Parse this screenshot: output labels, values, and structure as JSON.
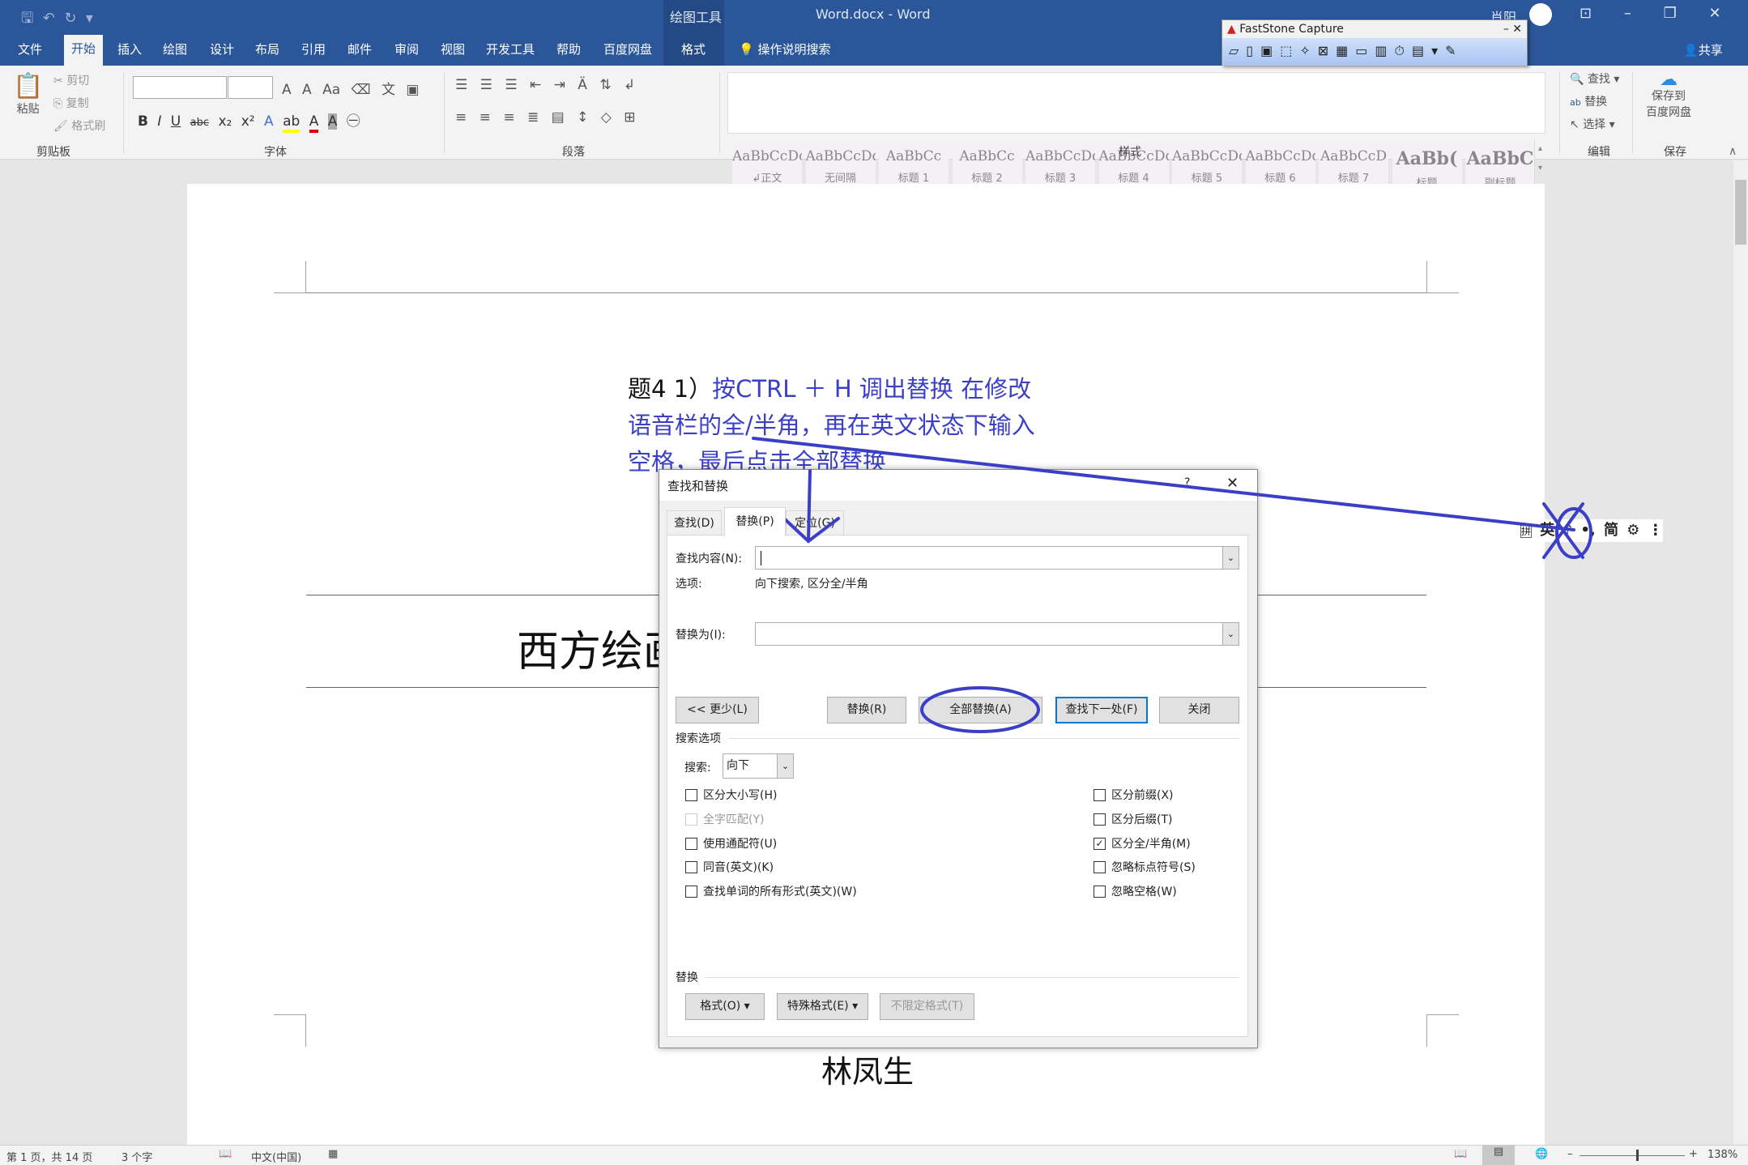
{
  "window": {
    "title": "Word.docx - Word",
    "context_tab_group": "绘图工具",
    "user": "肖阳",
    "share": "共享"
  },
  "tabs": [
    "文件",
    "开始",
    "插入",
    "绘图",
    "设计",
    "布局",
    "引用",
    "邮件",
    "审阅",
    "视图",
    "开发工具",
    "帮助",
    "百度网盘",
    "格式"
  ],
  "active_tab": "开始",
  "tell_me": "操作说明搜索",
  "ribbon": {
    "clipboard": {
      "label": "剪贴板",
      "paste": "粘贴",
      "cut": "剪切",
      "copy": "复制",
      "format_painter": "格式刷"
    },
    "font": {
      "label": "字体",
      "bold": "B",
      "italic": "I",
      "underline": "U",
      "strike": "abc",
      "sub": "x₂",
      "sup": "x²",
      "font_color": "#e00000",
      "highlight": "#ffff00"
    },
    "paragraph": {
      "label": "段落"
    },
    "styles": {
      "label": "样式",
      "items": [
        {
          "preview": "AaBbCcDc",
          "name": "↲正文"
        },
        {
          "preview": "AaBbCcDd",
          "name": "无间隔"
        },
        {
          "preview": "AaBbCc",
          "name": "标题 1"
        },
        {
          "preview": "AaBbCc",
          "name": "标题 2"
        },
        {
          "preview": "AaBbCcDdE",
          "name": "标题 3"
        },
        {
          "preview": "AaBbCcDdE",
          "name": "标题 4"
        },
        {
          "preview": "AaBbCcDdE",
          "name": "标题 5"
        },
        {
          "preview": "AaBbCcDdE",
          "name": "标题 6"
        },
        {
          "preview": "AaBbCcD",
          "name": "标题 7"
        },
        {
          "preview": "AaBb(",
          "name": "标题"
        },
        {
          "preview": "AaBbC",
          "name": "副标题"
        }
      ]
    },
    "editing": {
      "label": "编辑",
      "find": "查找",
      "replace": "替换",
      "select": "选择"
    },
    "save": {
      "label": "保存",
      "button": "保存到\n百度网盘"
    }
  },
  "faststone": {
    "title": "FastStone Capture"
  },
  "document": {
    "instruction_prefix": "题4 1）",
    "instruction_lines": [
      "按CTRL ＋ H 调出替换 在修改",
      "语音栏的全/半角，再在英文状态下输入",
      "空格，最后点击全部替换"
    ],
    "heading": "西方绘画",
    "author": "林凤生",
    "annotation_color": "#3a3fc6"
  },
  "ime_bar": {
    "mode": "拼",
    "lang": "英",
    "width": "♪",
    "punct": "•,",
    "script": "简",
    "settings": "⚙"
  },
  "dialog": {
    "title": "查找和替换",
    "help": "?",
    "close": "✕",
    "tabs": [
      "查找(D)",
      "替换(P)",
      "定位(G)"
    ],
    "active_tab": "替换(P)",
    "find_label": "查找内容(N):",
    "find_value": "",
    "options_label": "选项:",
    "options_value": "向下搜索, 区分全/半角",
    "replace_label": "替换为(I):",
    "replace_value": "",
    "buttons": {
      "less": "<< 更少(L)",
      "replace": "替换(R)",
      "replace_all": "全部替换(A)",
      "find_next": "查找下一处(F)",
      "close": "关闭"
    },
    "search_options_label": "搜索选项",
    "search_label": "搜索:",
    "search_value": "向下",
    "left_checks": [
      {
        "label": "区分大小写(H)",
        "checked": false
      },
      {
        "label": "全字匹配(Y)",
        "checked": false,
        "disabled": true
      },
      {
        "label": "使用通配符(U)",
        "checked": false
      },
      {
        "label": "同音(英文)(K)",
        "checked": false
      },
      {
        "label": "查找单词的所有形式(英文)(W)",
        "checked": false
      }
    ],
    "right_checks": [
      {
        "label": "区分前缀(X)",
        "checked": false
      },
      {
        "label": "区分后缀(T)",
        "checked": false
      },
      {
        "label": "区分全/半角(M)",
        "checked": true
      },
      {
        "label": "忽略标点符号(S)",
        "checked": false
      },
      {
        "label": "忽略空格(W)",
        "checked": false
      }
    ],
    "replace_section": "替换",
    "format_buttons": {
      "format": "格式(O) ▾",
      "special": "特殊格式(E) ▾",
      "no_format": "不限定格式(T)"
    }
  },
  "status": {
    "page": "第 1 页，共 14 页",
    "words": "3 个字",
    "language": "中文(中国)",
    "zoom": "138%"
  }
}
